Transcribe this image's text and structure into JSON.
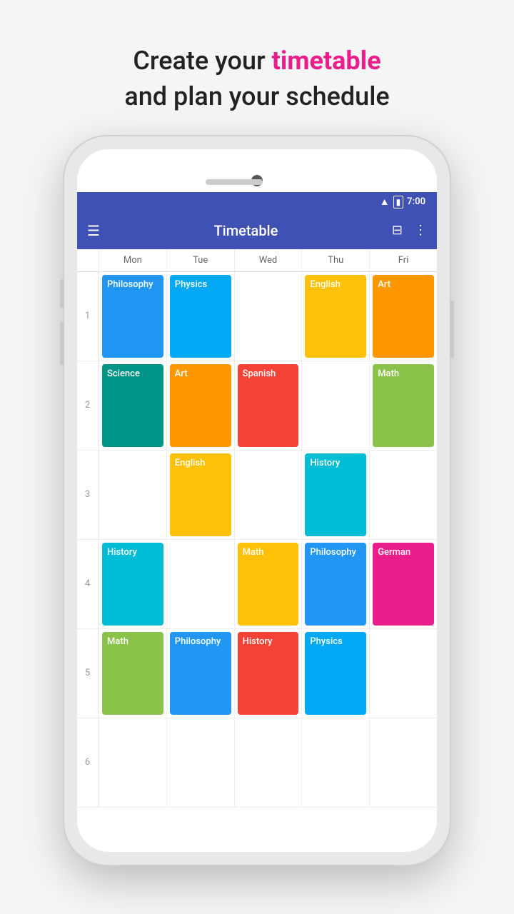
{
  "headline": {
    "line1_pre": "Create your ",
    "line1_highlight": "timetable",
    "line2": "and plan your schedule"
  },
  "status": {
    "time": "7:00"
  },
  "appbar": {
    "title": "Timetable",
    "menu_label": "☰",
    "grid_icon": "⊟",
    "more_icon": "⋮"
  },
  "days": [
    "Mon",
    "Tue",
    "Wed",
    "Thu",
    "Fri"
  ],
  "periods": [
    {
      "num": "1",
      "cells": [
        {
          "subject": "Philosophy",
          "color": "blue"
        },
        {
          "subject": "Physics",
          "color": "light-blue"
        },
        {
          "subject": "",
          "color": ""
        },
        {
          "subject": "English",
          "color": "yellow"
        },
        {
          "subject": "Art",
          "color": "orange"
        }
      ]
    },
    {
      "num": "2",
      "cells": [
        {
          "subject": "Science",
          "color": "teal"
        },
        {
          "subject": "Art",
          "color": "orange"
        },
        {
          "subject": "Spanish",
          "color": "red-orange"
        },
        {
          "subject": "",
          "color": ""
        },
        {
          "subject": "Math",
          "color": "green"
        }
      ]
    },
    {
      "num": "3",
      "cells": [
        {
          "subject": "",
          "color": ""
        },
        {
          "subject": "English",
          "color": "yellow"
        },
        {
          "subject": "",
          "color": ""
        },
        {
          "subject": "History",
          "color": "cyan"
        },
        {
          "subject": "",
          "color": ""
        }
      ]
    },
    {
      "num": "4",
      "cells": [
        {
          "subject": "History",
          "color": "cyan"
        },
        {
          "subject": "",
          "color": ""
        },
        {
          "subject": "Math",
          "color": "yellow"
        },
        {
          "subject": "Philosophy",
          "color": "blue"
        },
        {
          "subject": "German",
          "color": "pink"
        }
      ]
    },
    {
      "num": "5",
      "cells": [
        {
          "subject": "Math",
          "color": "green"
        },
        {
          "subject": "Philosophy",
          "color": "blue"
        },
        {
          "subject": "History",
          "color": "red-orange"
        },
        {
          "subject": "Physics",
          "color": "light-blue"
        },
        {
          "subject": "",
          "color": ""
        }
      ]
    },
    {
      "num": "6",
      "cells": [
        {
          "subject": "",
          "color": ""
        },
        {
          "subject": "",
          "color": ""
        },
        {
          "subject": "",
          "color": ""
        },
        {
          "subject": "",
          "color": ""
        },
        {
          "subject": "",
          "color": ""
        }
      ]
    }
  ]
}
